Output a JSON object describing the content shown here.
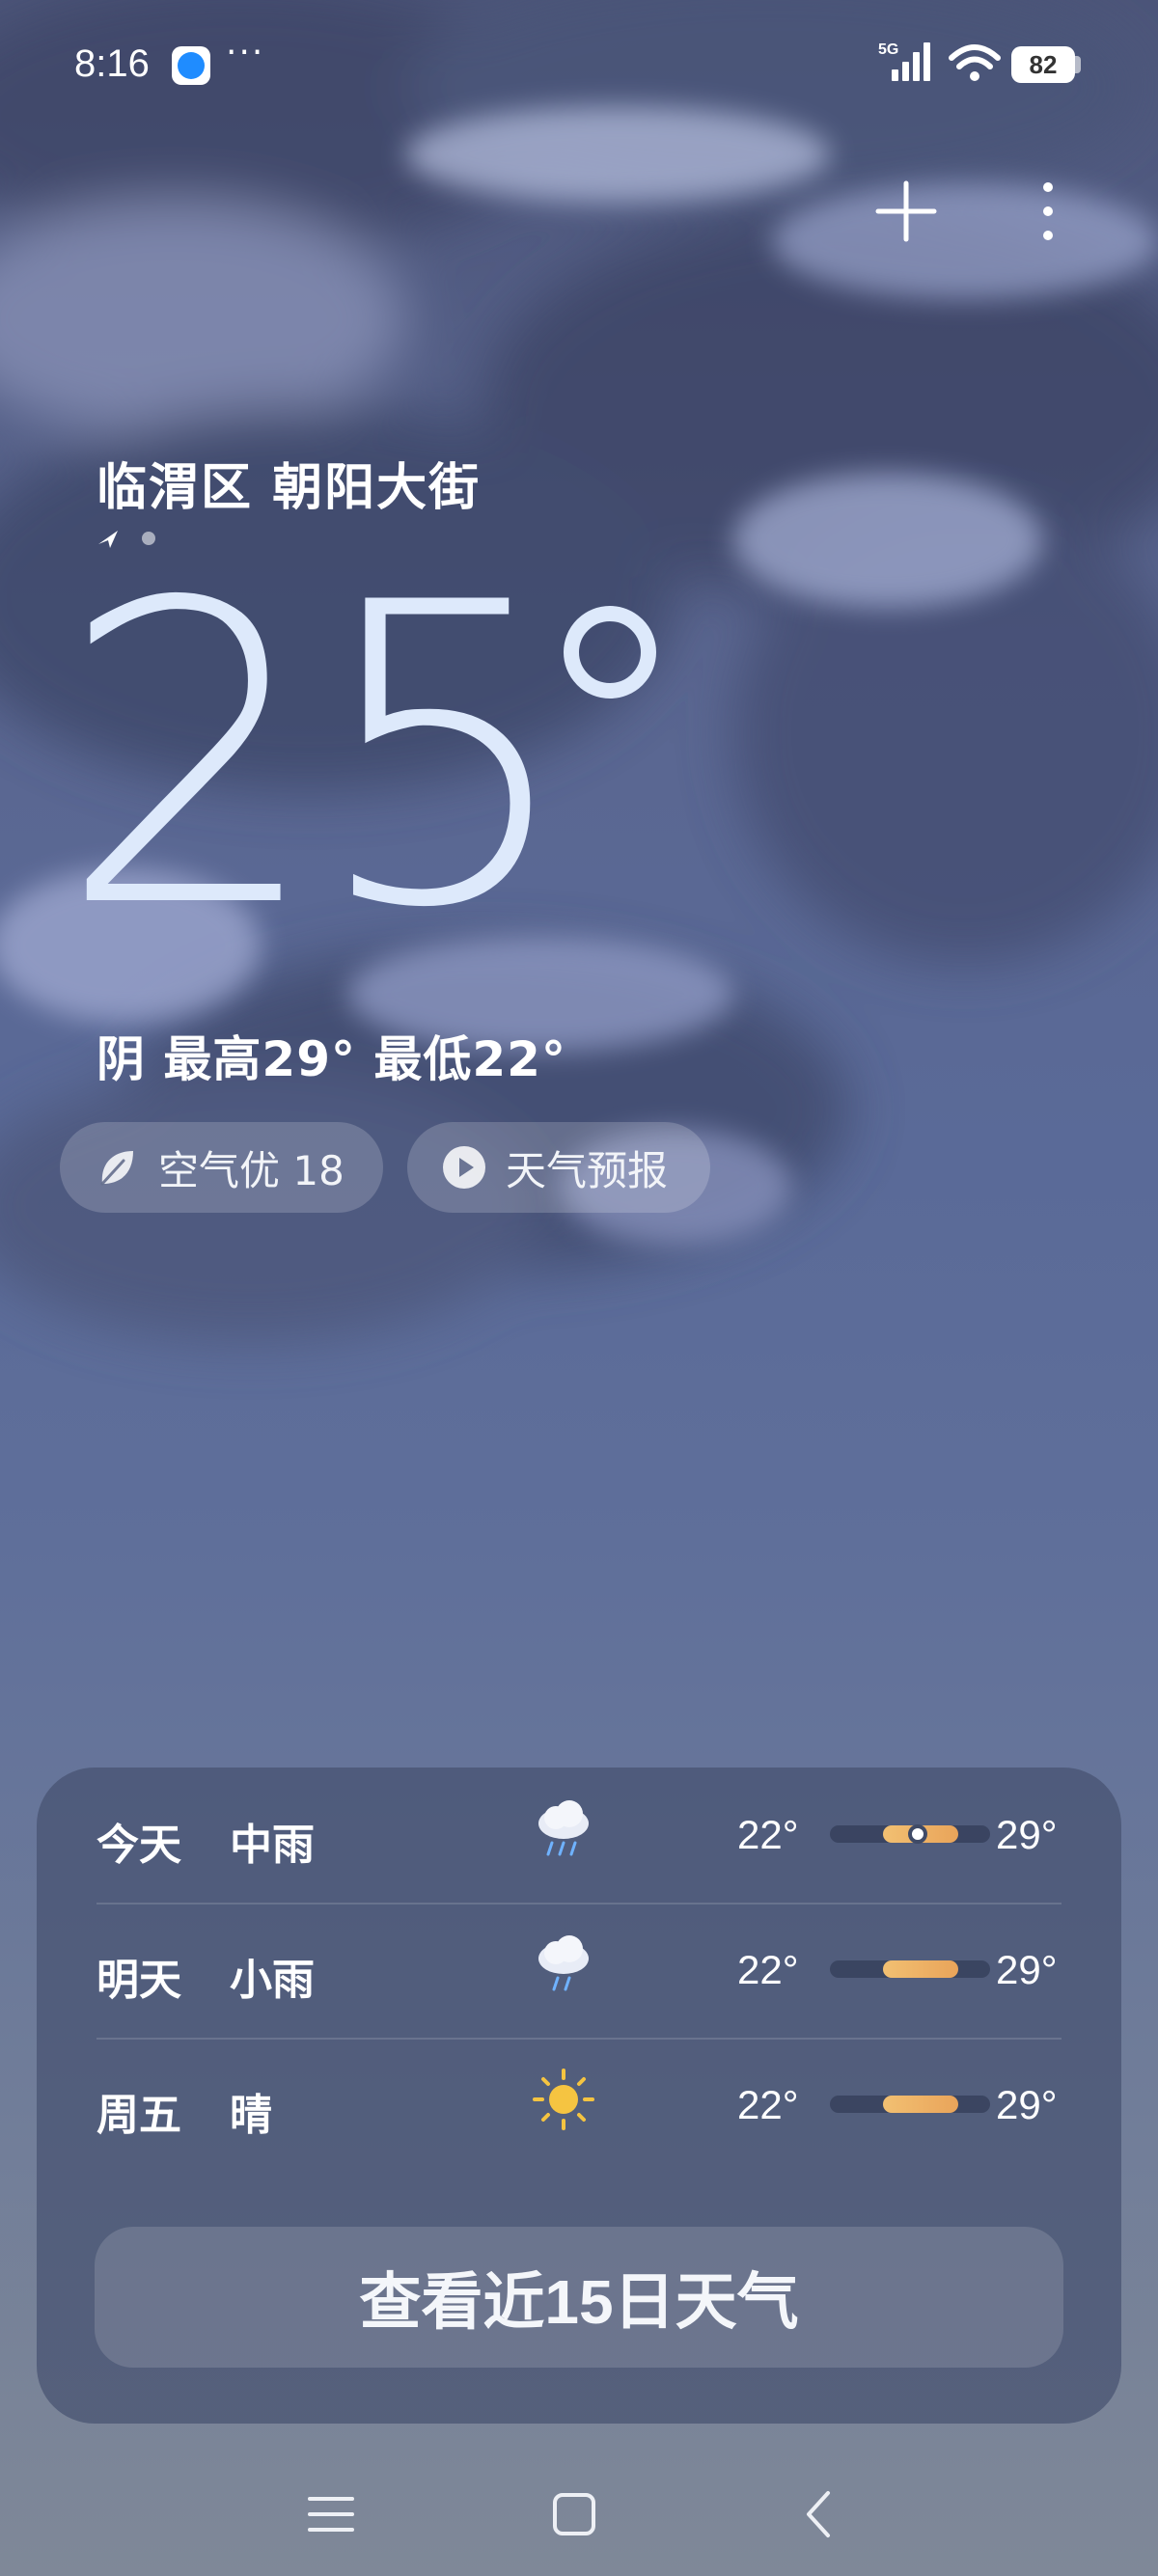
{
  "status_bar": {
    "time": "8:16",
    "more_indicator": "···",
    "network": "5G",
    "battery": "82",
    "app_icon": "browser-icon"
  },
  "header": {
    "add_icon": "plus-icon",
    "menu_icon": "more-vertical-icon"
  },
  "location": {
    "name": "临渭区 朝阳大街",
    "indicator_icon": "location-arrow-icon",
    "page_count": 2,
    "active_page": 1
  },
  "current": {
    "temperature": "25",
    "condition_line": "阴  最高29° 最低22°"
  },
  "pills": {
    "air_quality": "空气优 18",
    "air_icon": "leaf-icon",
    "forecast": "天气预报",
    "forecast_icon": "play-icon"
  },
  "forecast": {
    "rows": [
      {
        "day": "今天",
        "condition": "中雨",
        "icon": "rain-cloud-icon",
        "low": "22°",
        "high": "29°",
        "range_start": 0.33,
        "range_end": 0.8,
        "now": 0.55,
        "show_now": true
      },
      {
        "day": "明天",
        "condition": "小雨",
        "icon": "rain-cloud-icon",
        "low": "22°",
        "high": "29°",
        "range_start": 0.33,
        "range_end": 0.8,
        "show_now": false
      },
      {
        "day": "周五",
        "condition": "晴",
        "icon": "sun-icon",
        "low": "22°",
        "high": "29°",
        "range_start": 0.33,
        "range_end": 0.8,
        "show_now": false
      }
    ],
    "more_button_label": "查看近15日天气"
  },
  "nav": {
    "menu_icon": "menu-icon",
    "home_icon": "home-square-icon",
    "back_icon": "back-chevron-icon"
  },
  "colors": {
    "temperature": "#dde9fb",
    "range_fill": "#f2c072",
    "card_bg": "#465270"
  }
}
